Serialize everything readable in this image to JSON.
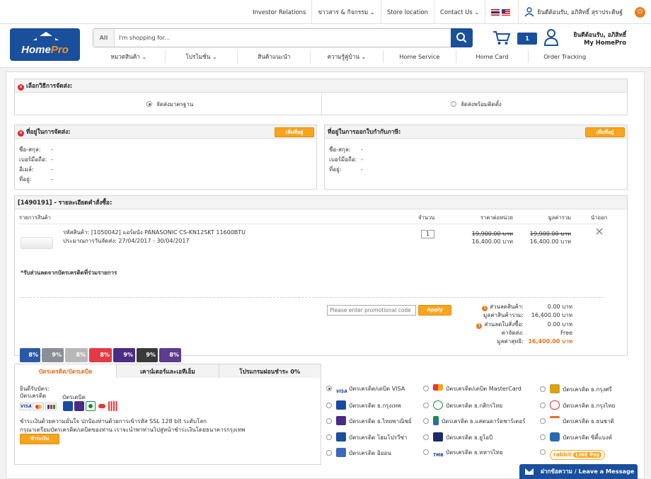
{
  "topbar": {
    "links": [
      "Investor Relations",
      "ข่าวสาร & กิจกรรม",
      "Store location",
      "Contact Us"
    ],
    "user_greeting": "ยินดีต้อนรับ, อภิสิทธิ์ สุราประดิษฐ์"
  },
  "header": {
    "logo_text_a": "Home",
    "logo_text_b": "Pro",
    "search_scope": "All",
    "search_placeholder": "I'm shopping for...",
    "cart_count": "1",
    "greeting_line1": "ยินดีต้อนรับ, อภิสิทธิ์",
    "greeting_line2": "My HomePro",
    "nav": [
      "หมวดสินค้า",
      "โปรโมชั่น",
      "สินค้าแนะนำ",
      "ความรู้คู่บ้าน",
      "Home Service",
      "Home Card",
      "Order Tracking"
    ]
  },
  "delivery": {
    "title": "เลือกวิธีการจัดส่ง:",
    "option_standard": "จัดส่งมาตรฐาน",
    "option_install": "จัดส่งพร้อมติดตั้ง"
  },
  "shipping_address": {
    "title": "ที่อยู่ในการจัดส่ง:",
    "add_button": "เพิ่มที่อยู่",
    "fields": [
      {
        "label": "ชื่อ-สกุล:",
        "value": "-"
      },
      {
        "label": "เบอร์มือถือ:",
        "value": "-"
      },
      {
        "label": "อีเมล์:",
        "value": "-"
      },
      {
        "label": "ที่อยู่:",
        "value": "-"
      }
    ]
  },
  "tax_address": {
    "title": "ที่อยู่ในการออกใบกำกับภาษี:",
    "add_button": "เพิ่มที่อยู่",
    "fields": [
      {
        "label": "ชื่อ-สกุล:",
        "value": "-"
      },
      {
        "label": "เบอร์มือถือ:",
        "value": "-"
      },
      {
        "label": "ที่อยู่:",
        "value": "-"
      }
    ]
  },
  "order": {
    "title": "[1490191] - รายละเอียดคำสั่งซื้อ:",
    "columns": [
      "รายการสินค้า",
      "จำนวน",
      "ราคาต่อหน่วย",
      "มูลค่ารวม",
      "นำออก"
    ],
    "item": {
      "line1": "รหัสสินค้า: [1050042] แอร์ผนัง PANASONIC CS-KN12SKT 11600BTU",
      "line2": "ประมาณการวันจัดส่ง: 27/04/2017 - 30/04/2017",
      "qty": "1",
      "unit_old": "19,900.00 บาท",
      "unit_new": "16,400.00 บาท",
      "total_old": "19,900.00 บาท",
      "total_new": "16,400.00 บาท"
    },
    "card_promo_title": "*รับส่วนลดจากบัตรเครดิตที่ร่วมรายการ",
    "card_badges": [
      {
        "value": "8",
        "suffix": "%",
        "color": "#2a5aa7"
      },
      {
        "value": "9",
        "suffix": "%",
        "color": "#8a8f96"
      },
      {
        "value": "8",
        "suffix": "%",
        "color": "#b8b8b8"
      },
      {
        "value": "8",
        "suffix": "%",
        "color": "#e33a45"
      },
      {
        "value": "9",
        "suffix": "%",
        "color": "#4b2c85"
      },
      {
        "value": "9",
        "suffix": "%",
        "color": "#3a3a3a"
      },
      {
        "value": "8",
        "suffix": "%",
        "color": "#5d3b8e"
      }
    ],
    "promo_placeholder": "Please enter promotional code",
    "apply_label": "Apply",
    "summary": [
      {
        "label": "ส่วนลดสินค้า:",
        "value": "0.00 บาท",
        "icon": true
      },
      {
        "label": "มูลค่าสินค้ารวม:",
        "value": "16,400.00 บาท",
        "icon": false
      },
      {
        "label": "ส่วนลดใบสั่งซื้อ:",
        "value": "0.00 บาท",
        "icon": true
      },
      {
        "label": "ค่าจัดส่ง:",
        "value": "Free",
        "icon": false
      }
    ],
    "net_label": "มูลค่าสุทธิ:",
    "net_value": "16,400.00 บาท"
  },
  "payment": {
    "tabs": [
      "บัตรเครดิต/บัตรเดบิต",
      "เคาน์เตอร์และเอทีเอ็ม",
      "โปรแกรมผ่อนชำระ 0%"
    ],
    "accepted_title": "ยินดีรับบัตร:",
    "credit_label": "บัตรเครดิต",
    "debit_label": "บัตรเดบิต",
    "security_line1": "ชำระเงินด้วยความมั่นใจ ปกป้องท่านด้วยการเข้ารหัส SSL 128 bit ระดับโลก",
    "security_line2": "กรุณาเตรียมบัตรเครดิต/เดบิตของท่าน เราจะนำพาท่านไปสู่หน้าชำระเงินโดยธนาคารกรุงเทพ",
    "pay_button": "ชำระเงิน",
    "methods": [
      {
        "label": "บัตรเครดิต/เดบิต VISA",
        "color": "#1a3e9a",
        "selected": true
      },
      {
        "label": "บัตรเครดิต/เดบิต MasterCard",
        "color": "#eb6a1e",
        "selected": false
      },
      {
        "label": "บัตรเครดิต ธ.กรุงศรี",
        "color": "#d5a21a",
        "selected": false
      },
      {
        "label": "บัตรเครดิต ธ.กรุงเทพ",
        "color": "#1a4aa0",
        "selected": false
      },
      {
        "label": "บัตรเครดิต ธ.กสิกรไทย",
        "color": "#1a8a3a",
        "selected": false
      },
      {
        "label": "บัตรเครดิต ธ.กรุงไทย",
        "color": "#2aa0dc",
        "selected": false
      },
      {
        "label": "บัตรเครดิต ธ.ไทยพาณิชย์",
        "color": "#4b2c85",
        "selected": false
      },
      {
        "label": "บัตรเครดิต ธ.แสตนดาร์ดชาร์เตอร์",
        "color": "#1a8a5a",
        "selected": false
      },
      {
        "label": "บัตรเครดิต ธ.ธนชาติ",
        "color": "#e6711c",
        "selected": false
      },
      {
        "label": "บัตรเครดิต โฮมโปรวีซ่า",
        "color": "#1a4f9c",
        "selected": false
      },
      {
        "label": "บัตรเครดิต ธ.ยูโอบี",
        "color": "#1a2a6a",
        "selected": false
      },
      {
        "label": "บัตรเครดิต ซิตี้แบงค์",
        "color": "#2a6ab0",
        "selected": false
      },
      {
        "label": "บัตรเครดิต อิออน",
        "color": "#3a6ab8",
        "selected": false
      },
      {
        "label": "บัตรเครดิต ธ.ทหารไทย",
        "color": "#1a3a8a",
        "selected": false
      }
    ],
    "rabbit_label": "rabbit",
    "linepay_label": "LINE Pay"
  },
  "live_chat": {
    "label": "ฝากข้อความ / Leave a Message"
  }
}
